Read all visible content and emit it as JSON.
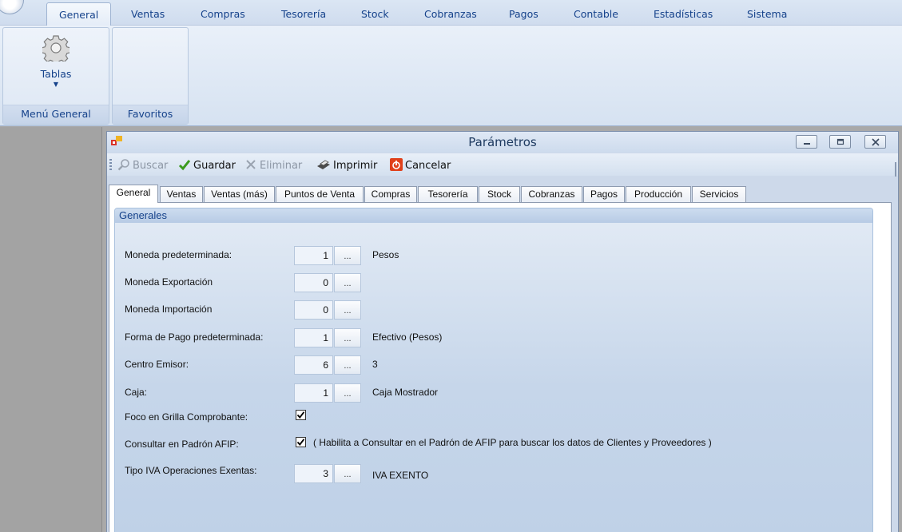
{
  "ribbon": {
    "tabs": [
      "General",
      "Ventas",
      "Compras",
      "Tesorería",
      "Stock",
      "Cobranzas",
      "Pagos",
      "Contable",
      "Estadísticas",
      "Sistema"
    ],
    "groups": {
      "menu_general": {
        "button_label": "Tablas",
        "caption": "Menú General"
      },
      "favoritos": {
        "caption": "Favoritos"
      }
    }
  },
  "window": {
    "title": "Parámetros",
    "toolbar": {
      "buscar": "Buscar",
      "guardar": "Guardar",
      "eliminar": "Eliminar",
      "imprimir": "Imprimir",
      "cancelar": "Cancelar"
    },
    "tabs": [
      "General",
      "Ventas",
      "Ventas (más)",
      "Puntos de Venta",
      "Compras",
      "Tesorería",
      "Stock",
      "Cobranzas",
      "Pagos",
      "Producción",
      "Servicios"
    ],
    "active_tab": "General",
    "panel": {
      "header": "Generales",
      "lookup_button": "...",
      "fields": [
        {
          "label": "Moneda predeterminada:",
          "value": "1",
          "description": "Pesos"
        },
        {
          "label": "Moneda Exportación",
          "value": "0",
          "description": ""
        },
        {
          "label": "Moneda Importación",
          "value": "0",
          "description": ""
        },
        {
          "label": "Forma de Pago predeterminada:",
          "value": "1",
          "description": "Efectivo (Pesos)"
        },
        {
          "label": "Centro Emisor:",
          "value": "6",
          "description": "3"
        },
        {
          "label": "Caja:",
          "value": "1",
          "description": "Caja Mostrador"
        }
      ],
      "checks": [
        {
          "label": "Foco en Grilla Comprobante:",
          "checked": true,
          "description": ""
        },
        {
          "label": "Consultar en Padrón AFIP:",
          "checked": true,
          "description": "( Habilita a Consultar en el Padrón de AFIP para buscar los datos de Clientes y Proveedores )"
        }
      ],
      "iva_field": {
        "label": "Tipo IVA Operaciones Exentas:",
        "value": "3",
        "description": "IVA EXENTO"
      }
    }
  },
  "colors": {
    "ribbon_text": "#15428b",
    "guardar_icon": "#3a9a1c",
    "cancelar_icon": "#e0401a"
  },
  "icons": {
    "tablas": "gear-icon",
    "buscar": "magnifier-icon",
    "guardar": "checkmark-icon",
    "eliminar": "x-icon",
    "imprimir": "printer-icon",
    "cancelar": "power-icon"
  }
}
